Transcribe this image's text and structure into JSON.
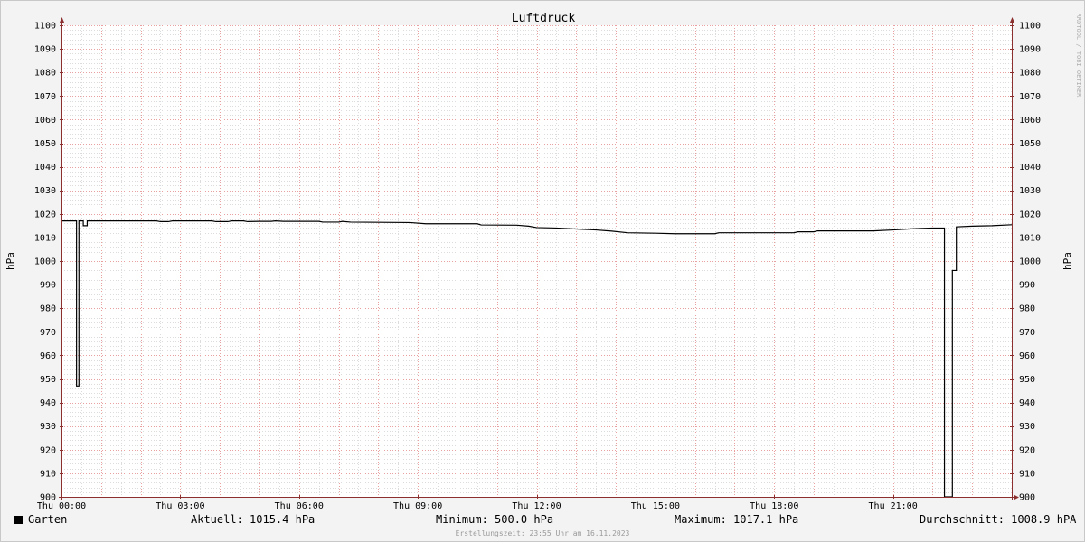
{
  "chart_data": {
    "type": "line",
    "title": "Luftdruck",
    "ylabel": "hPa",
    "ylabel_right": "hPa",
    "watermark": "RRDTOOL / TOBI OETIKER",
    "ylim": [
      900,
      1100
    ],
    "y_ticks": [
      900,
      910,
      920,
      930,
      940,
      950,
      960,
      970,
      980,
      990,
      1000,
      1010,
      1020,
      1030,
      1040,
      1050,
      1060,
      1070,
      1080,
      1090,
      1100
    ],
    "xlim": [
      0,
      24
    ],
    "x_ticks": [
      {
        "t": 0,
        "label": "Thu 00:00"
      },
      {
        "t": 3,
        "label": "Thu 03:00"
      },
      {
        "t": 6,
        "label": "Thu 06:00"
      },
      {
        "t": 9,
        "label": "Thu 09:00"
      },
      {
        "t": 12,
        "label": "Thu 12:00"
      },
      {
        "t": 15,
        "label": "Thu 15:00"
      },
      {
        "t": 18,
        "label": "Thu 18:00"
      },
      {
        "t": 21,
        "label": "Thu 21:00"
      }
    ],
    "series": [
      {
        "name": "Garten",
        "color": "#000000",
        "points": [
          [
            0.0,
            1017.0
          ],
          [
            0.38,
            1017.0
          ],
          [
            0.38,
            947.0
          ],
          [
            0.44,
            947.0
          ],
          [
            0.44,
            1017.0
          ],
          [
            0.55,
            1017.0
          ],
          [
            0.55,
            1015.0
          ],
          [
            0.65,
            1015.0
          ],
          [
            0.65,
            1017.0
          ],
          [
            2.4,
            1017.0
          ],
          [
            2.5,
            1016.7
          ],
          [
            2.7,
            1016.7
          ],
          [
            2.8,
            1017.0
          ],
          [
            3.8,
            1017.0
          ],
          [
            3.9,
            1016.7
          ],
          [
            4.2,
            1016.7
          ],
          [
            4.3,
            1017.0
          ],
          [
            4.6,
            1017.0
          ],
          [
            4.7,
            1016.7
          ],
          [
            5.0,
            1016.8
          ],
          [
            5.3,
            1016.8
          ],
          [
            5.4,
            1017.0
          ],
          [
            5.6,
            1016.8
          ],
          [
            6.5,
            1016.8
          ],
          [
            6.6,
            1016.5
          ],
          [
            7.0,
            1016.5
          ],
          [
            7.1,
            1016.8
          ],
          [
            7.3,
            1016.5
          ],
          [
            8.8,
            1016.3
          ],
          [
            9.2,
            1015.8
          ],
          [
            10.5,
            1015.8
          ],
          [
            10.6,
            1015.3
          ],
          [
            11.5,
            1015.2
          ],
          [
            11.8,
            1014.8
          ],
          [
            12.0,
            1014.2
          ],
          [
            12.5,
            1014.0
          ],
          [
            13.0,
            1013.6
          ],
          [
            13.5,
            1013.2
          ],
          [
            13.9,
            1012.7
          ],
          [
            14.3,
            1012.0
          ],
          [
            15.0,
            1011.8
          ],
          [
            15.5,
            1011.6
          ],
          [
            16.5,
            1011.6
          ],
          [
            16.6,
            1012.0
          ],
          [
            18.5,
            1012.0
          ],
          [
            18.6,
            1012.4
          ],
          [
            19.0,
            1012.4
          ],
          [
            19.1,
            1012.8
          ],
          [
            20.5,
            1012.8
          ],
          [
            21.0,
            1013.2
          ],
          [
            21.5,
            1013.7
          ],
          [
            22.0,
            1014.0
          ],
          [
            22.3,
            1014.0
          ],
          [
            22.3,
            500.0
          ],
          [
            22.5,
            500.0
          ],
          [
            22.5,
            996.0
          ],
          [
            22.6,
            996.0
          ],
          [
            22.6,
            1014.5
          ],
          [
            23.0,
            1014.8
          ],
          [
            23.5,
            1015.0
          ],
          [
            24.0,
            1015.4
          ]
        ]
      }
    ]
  },
  "legend": {
    "series_name": "Garten",
    "current": "Aktuell: 1015.4 hPa",
    "minimum": "Minimum: 500.0 hPa",
    "maximum": "Maximum: 1017.1 hPa",
    "average": "Durchschnitt: 1008.9 hPA"
  },
  "footer": {
    "created": "Erstellungszeit: 23:55 Uhr am 16.11.2023"
  }
}
